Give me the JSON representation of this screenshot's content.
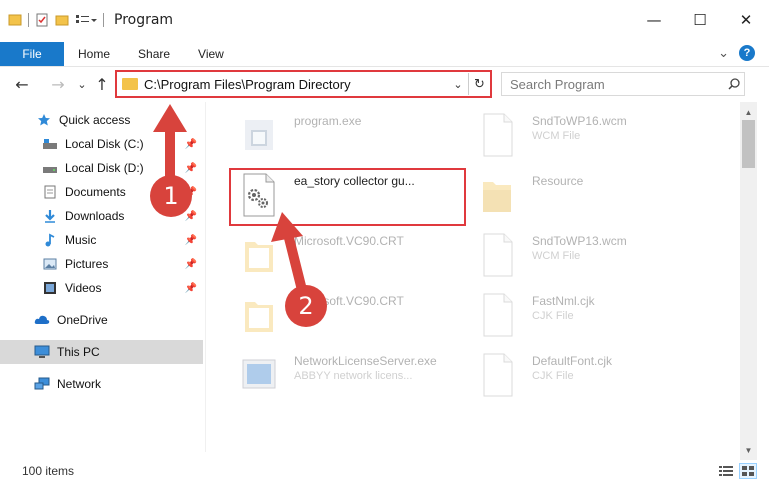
{
  "window": {
    "title": "Program",
    "minimize_glyph": "—",
    "maximize_glyph": "☐",
    "close_glyph": "✕"
  },
  "ribbon": {
    "tabs": [
      "File",
      "Home",
      "Share",
      "View"
    ],
    "expand_glyph": "⌄",
    "help_glyph": "?"
  },
  "navigation": {
    "back_glyph": "←",
    "forward_glyph": "→",
    "recent_glyph": "⌄",
    "up_glyph": "↑"
  },
  "address": {
    "path": "C:\\Program Files\\Program Directory",
    "dropdown_glyph": "⌄",
    "refresh_glyph": "↻"
  },
  "search": {
    "placeholder": "Search Program"
  },
  "sidebar": {
    "items": [
      {
        "label": "Quick access",
        "icon": "star-icon"
      },
      {
        "label": "Local Disk (C:)",
        "icon": "drive-icon",
        "pinned": true
      },
      {
        "label": "Local Disk (D:)",
        "icon": "drive-icon",
        "pinned": true
      },
      {
        "label": "Documents",
        "icon": "documents-icon",
        "pinned": true
      },
      {
        "label": "Downloads",
        "icon": "downloads-icon",
        "pinned": true
      },
      {
        "label": "Music",
        "icon": "music-icon",
        "pinned": true
      },
      {
        "label": "Pictures",
        "icon": "pictures-icon",
        "pinned": true
      },
      {
        "label": "Videos",
        "icon": "videos-icon",
        "pinned": true
      },
      {
        "label": "OneDrive",
        "icon": "cloud-icon"
      },
      {
        "label": "This PC",
        "icon": "computer-icon",
        "selected": true
      },
      {
        "label": "Network",
        "icon": "network-icon"
      }
    ]
  },
  "files": {
    "left": [
      {
        "name": "program.exe",
        "type": ""
      },
      {
        "name": "ea_story collector gu...",
        "type": ""
      },
      {
        "name": "Microsoft.VC90.CRT",
        "type": ""
      },
      {
        "name": "Microsoft.VC90.CRT",
        "type": ""
      },
      {
        "name": "NetworkLicenseServer.exe",
        "type": "ABBYY network licens..."
      }
    ],
    "right": [
      {
        "name": "SndToWP16.wcm",
        "type": "WCM File"
      },
      {
        "name": "Resource",
        "type": ""
      },
      {
        "name": "SndToWP13.wcm",
        "type": "WCM File"
      },
      {
        "name": "FastNml.cjk",
        "type": "CJK File"
      },
      {
        "name": "DefaultFont.cjk",
        "type": "CJK File"
      }
    ]
  },
  "status": {
    "item_count": "100 items"
  },
  "annotations": {
    "callout_1": "1",
    "callout_2": "2"
  },
  "colors": {
    "accent": "#1979ca",
    "highlight": "#e0393d",
    "folder": "#f3c34a"
  }
}
